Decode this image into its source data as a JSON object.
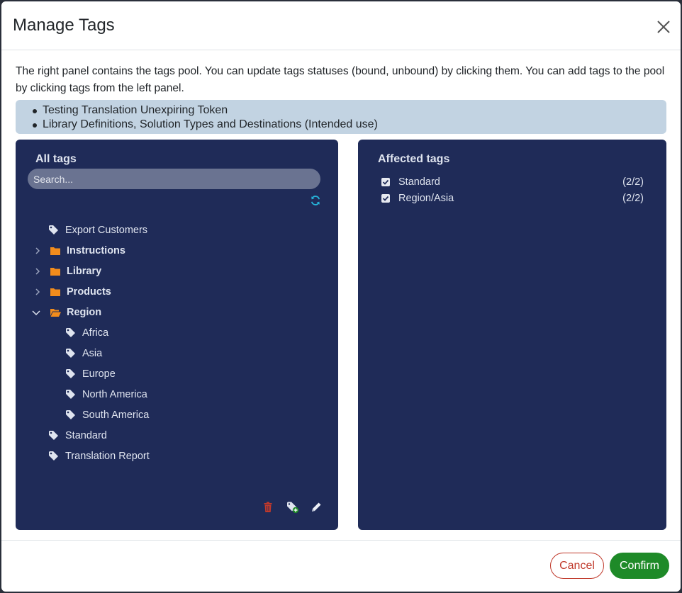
{
  "modal": {
    "title": "Manage Tags",
    "description": "The right panel contains the tags pool. You can update tags statuses (bound, unbound) by clicking them. You can add tags to the pool by clicking tags from the left panel.",
    "selected_items": [
      "Testing Translation Unexpiring Token",
      "Library Definitions, Solution Types and Destinations (Intended use)"
    ]
  },
  "all_tags": {
    "title": "All tags",
    "search_placeholder": "Search...",
    "tree": [
      {
        "label": "Export Customers",
        "type": "tag"
      },
      {
        "label": "Instructions",
        "type": "folder",
        "expanded": false
      },
      {
        "label": "Library",
        "type": "folder",
        "expanded": false
      },
      {
        "label": "Products",
        "type": "folder",
        "expanded": false
      },
      {
        "label": "Region",
        "type": "folder",
        "expanded": true
      },
      {
        "label": "Africa",
        "type": "tag",
        "parent": "Region"
      },
      {
        "label": "Asia",
        "type": "tag",
        "parent": "Region"
      },
      {
        "label": "Europe",
        "type": "tag",
        "parent": "Region"
      },
      {
        "label": "North America",
        "type": "tag",
        "parent": "Region"
      },
      {
        "label": "South America",
        "type": "tag",
        "parent": "Region"
      },
      {
        "label": "Standard",
        "type": "tag"
      },
      {
        "label": "Translation Report",
        "type": "tag"
      }
    ]
  },
  "affected_tags": {
    "title": "Affected tags",
    "items": [
      {
        "label": "Standard",
        "count": "(2/2)",
        "checked": true
      },
      {
        "label": "Region/Asia",
        "count": "(2/2)",
        "checked": true
      }
    ]
  },
  "footer": {
    "cancel_label": "Cancel",
    "confirm_label": "Confirm"
  },
  "colors": {
    "panel_bg": "#1f2b58",
    "folder_icon": "#f28c1c",
    "cancel": "#c0392b",
    "confirm": "#1e8a28",
    "refresh": "#26b3d9",
    "delete": "#c0392b"
  }
}
